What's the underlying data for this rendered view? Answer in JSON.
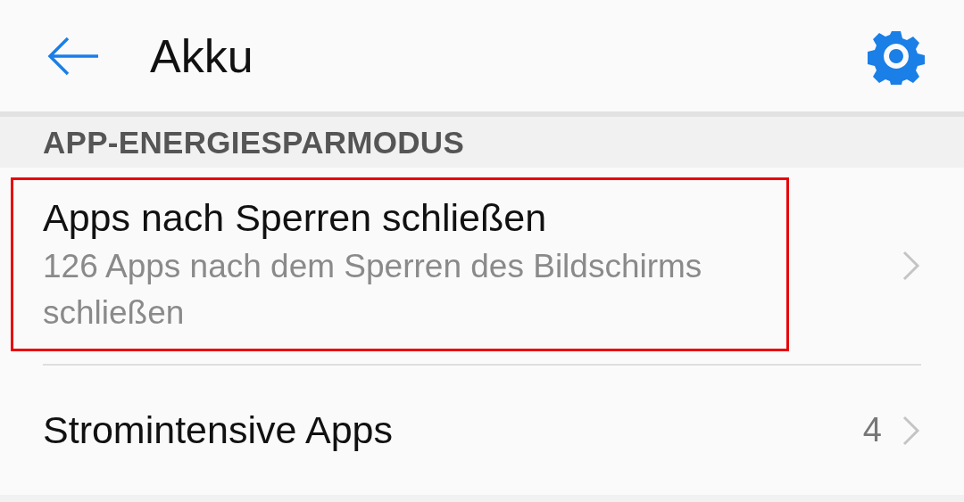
{
  "header": {
    "title": "Akku"
  },
  "section": {
    "title": "APP-ENERGIESPARMODUS"
  },
  "items": [
    {
      "title": "Apps nach Sperren schließen",
      "subtitle": "126 Apps nach dem Sperren des Bildschirms schließen",
      "highlighted": true
    },
    {
      "title": "Stromintensive Apps",
      "value": "4",
      "highlighted": false
    }
  ]
}
